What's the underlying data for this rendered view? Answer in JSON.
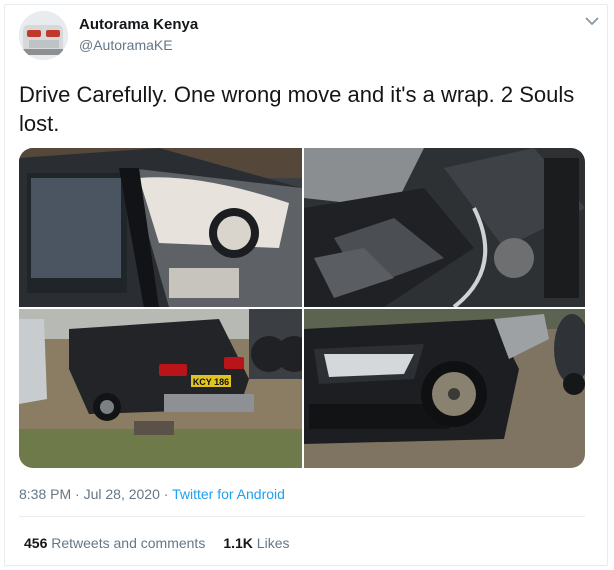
{
  "author": {
    "name": "Autorama Kenya",
    "handle": "@AutoramaKE"
  },
  "tweet": {
    "text": "Drive Carefully. One wrong move and it's a wrap. 2 Souls lost."
  },
  "media": {
    "photos": [
      {
        "subject": "car interior with deployed airbag"
      },
      {
        "subject": "crushed car body and engine wreckage"
      },
      {
        "subject": "wrecked car rear with plate"
      },
      {
        "subject": "damaged black car front"
      }
    ],
    "plate_text": "KCY 186"
  },
  "meta": {
    "time": "8:38 PM",
    "separator1": " · ",
    "date": "Jul 28, 2020",
    "separator2": " · ",
    "source": "Twitter for Android"
  },
  "stats": {
    "retweets_count": "456",
    "retweets_label": "Retweets and comments",
    "likes_count": "1.1K",
    "likes_label": "Likes"
  },
  "colors": {
    "text": "#14171a",
    "secondary": "#657786",
    "link": "#1da1f2",
    "border": "#e6ecf0"
  }
}
